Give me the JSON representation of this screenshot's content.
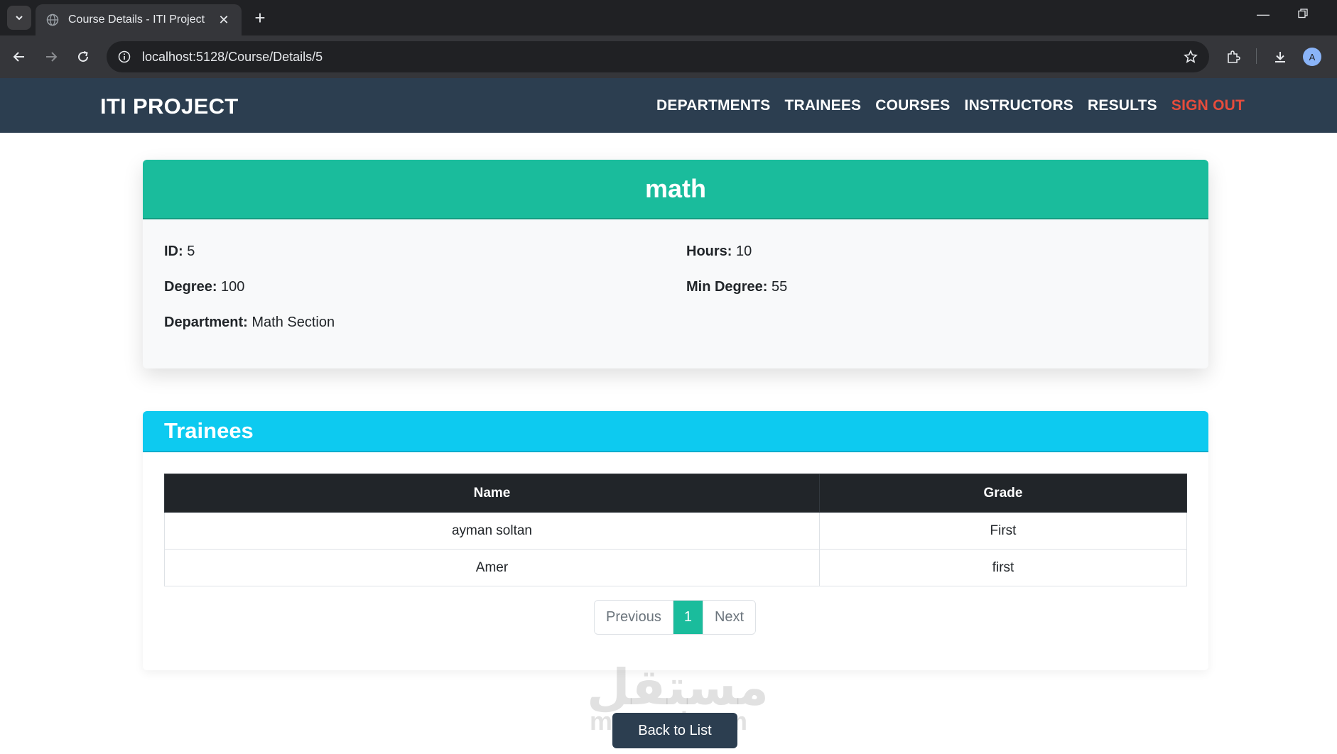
{
  "browser": {
    "tab_title": "Course Details - ITI Project",
    "url": "localhost:5128/Course/Details/5",
    "avatar_letter": "A"
  },
  "site": {
    "brand": "ITI PROJECT",
    "nav": [
      {
        "label": "DEPARTMENTS"
      },
      {
        "label": "TRAINEES"
      },
      {
        "label": "COURSES"
      },
      {
        "label": "INSTRUCTORS"
      },
      {
        "label": "RESULTS"
      },
      {
        "label": "SIGN OUT"
      }
    ]
  },
  "course": {
    "name": "math",
    "id_label": "ID:",
    "id_value": "5",
    "hours_label": "Hours:",
    "hours_value": "10",
    "degree_label": "Degree:",
    "degree_value": "100",
    "min_degree_label": "Min Degree:",
    "min_degree_value": "55",
    "department_label": "Department:",
    "department_value": "Math Section"
  },
  "trainees": {
    "title": "Trainees",
    "columns": [
      "Name",
      "Grade"
    ],
    "rows": [
      {
        "name": "ayman soltan",
        "grade": "First"
      },
      {
        "name": "Amer",
        "grade": "first"
      }
    ]
  },
  "pagination": {
    "previous": "Previous",
    "current": "1",
    "next": "Next"
  },
  "back_button": "Back to List",
  "watermark": {
    "arabic": "مستقل",
    "latin": "mostaql.com"
  },
  "colors": {
    "navbar": "#2c3e50",
    "course_header": "#1abc9c",
    "trainees_header": "#0dcaf0",
    "sign_out": "#e74c3c"
  }
}
